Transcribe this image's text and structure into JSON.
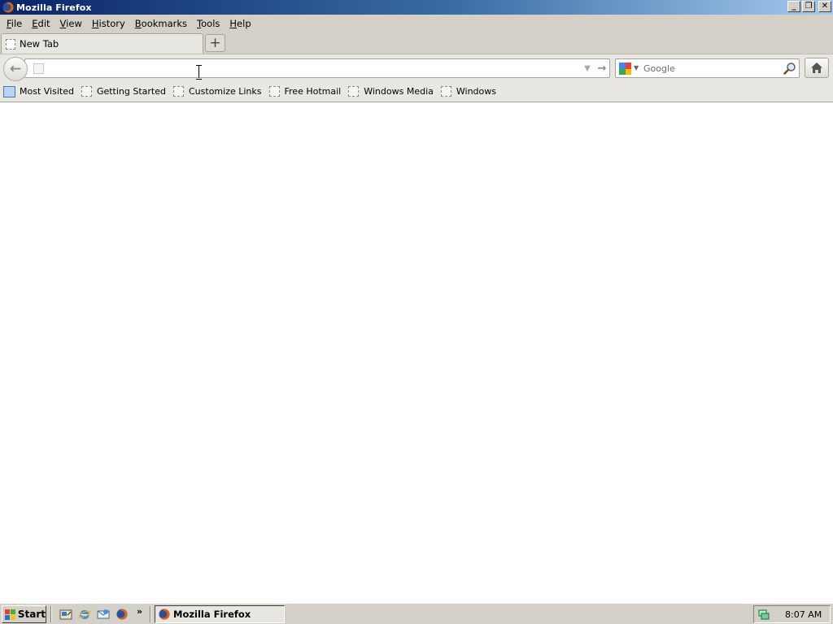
{
  "window": {
    "title": "Mozilla Firefox",
    "controls": {
      "minimize": "_",
      "restore": "❐",
      "close": "✕"
    }
  },
  "menubar": {
    "items": [
      {
        "label": "File",
        "accel": "F",
        "rest": "ile"
      },
      {
        "label": "Edit",
        "accel": "E",
        "rest": "dit"
      },
      {
        "label": "View",
        "accel": "V",
        "rest": "iew"
      },
      {
        "label": "History",
        "accel": "H",
        "rest": "istory"
      },
      {
        "label": "Bookmarks",
        "accel": "B",
        "rest": "ookmarks"
      },
      {
        "label": "Tools",
        "accel": "T",
        "rest": "ools"
      },
      {
        "label": "Help",
        "accel": "H",
        "rest": "elp"
      }
    ]
  },
  "tabs": {
    "items": [
      {
        "label": "New Tab",
        "active": true
      }
    ],
    "new_tab_symbol": "+"
  },
  "navbar": {
    "back_symbol": "←",
    "url_value": "",
    "go_symbol": "→",
    "dropdown_symbol": "▼"
  },
  "search": {
    "placeholder": "Google",
    "engine_icon": "google-icon",
    "brand_colors": [
      "#4285f4",
      "#ea4335",
      "#fbbc05",
      "#34a853"
    ]
  },
  "bookmarks": {
    "items": [
      {
        "label": "Most Visited",
        "icon": "most-visited-icon"
      },
      {
        "label": "Getting Started",
        "icon": "page-icon"
      },
      {
        "label": "Customize Links",
        "icon": "page-icon"
      },
      {
        "label": "Free Hotmail",
        "icon": "page-icon"
      },
      {
        "label": "Windows Media",
        "icon": "page-icon"
      },
      {
        "label": "Windows",
        "icon": "page-icon"
      }
    ]
  },
  "taskbar": {
    "start_label": "Start",
    "more_symbol": "»",
    "task_label": "Mozilla Firefox",
    "clock": "8:07 AM"
  }
}
